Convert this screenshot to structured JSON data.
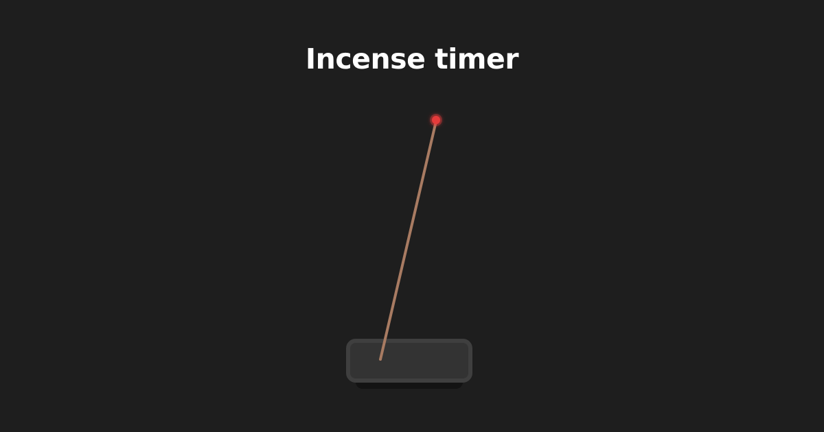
{
  "page": {
    "title": "Incense timer",
    "background_color": "#1e1e1e"
  },
  "incense": {
    "stick_color": "#a87b62",
    "ember_color": "#e53b3b",
    "holder_color": "#333333",
    "holder_border_color": "#3f3f3f"
  }
}
